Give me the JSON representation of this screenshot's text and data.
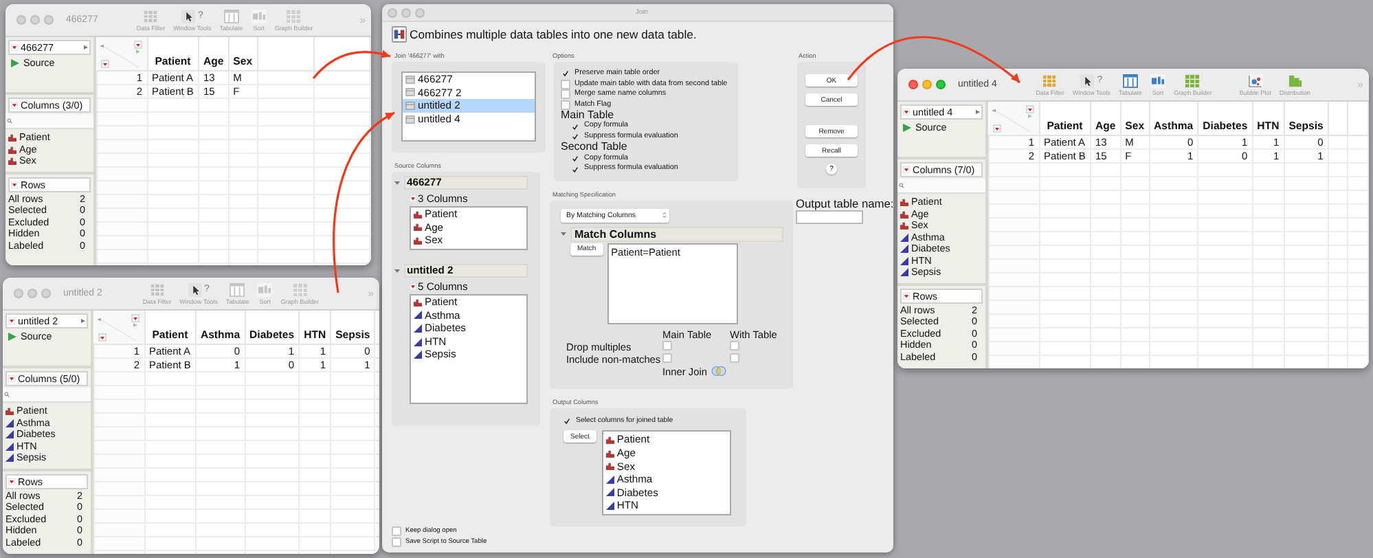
{
  "windows": [
    {
      "title": "466277",
      "active": false,
      "toolbar": [
        {
          "kind": "data-filter",
          "label": "Data Filter"
        },
        {
          "kind": "window-tools",
          "label": "Window Tools",
          "glyph": "?"
        },
        {
          "kind": "tabulate",
          "label": "Tabulate"
        },
        {
          "kind": "sort",
          "label": "Sort"
        },
        {
          "kind": "graph-builder",
          "label": "Graph Builder"
        }
      ],
      "overflow": "»",
      "table_name": "466277",
      "source": "Source",
      "columns_header": "Columns (3/0)",
      "columns": [
        {
          "name": "Patient",
          "kind": "nominal"
        },
        {
          "name": "Age",
          "kind": "nominal"
        },
        {
          "name": "Sex",
          "kind": "nominal"
        }
      ],
      "rows_header": "Rows",
      "row_stats": [
        {
          "label": "All rows",
          "value": "2"
        },
        {
          "label": "Selected",
          "value": "0"
        },
        {
          "label": "Excluded",
          "value": "0"
        },
        {
          "label": "Hidden",
          "value": "0"
        },
        {
          "label": "Labeled",
          "value": "0"
        }
      ],
      "grid_columns": [
        {
          "name": "Patient",
          "kind": "nominal"
        },
        {
          "name": "Age",
          "kind": "nominal"
        },
        {
          "name": "Sex",
          "kind": "nominal"
        }
      ],
      "data_rows": [
        {
          "number": "1",
          "cells": [
            "Patient A",
            "13",
            "M"
          ]
        },
        {
          "number": "2",
          "cells": [
            "Patient B",
            "15",
            "F"
          ]
        }
      ]
    },
    {
      "title": "untitled 2",
      "active": false,
      "toolbar": [
        {
          "kind": "data-filter",
          "label": "Data Filter"
        },
        {
          "kind": "window-tools",
          "label": "Window Tools",
          "glyph": "?"
        },
        {
          "kind": "tabulate",
          "label": "Tabulate"
        },
        {
          "kind": "sort",
          "label": "Sort"
        },
        {
          "kind": "graph-builder",
          "label": "Graph Builder"
        }
      ],
      "overflow": "»",
      "table_name": "untitled 2",
      "source": "Source",
      "columns_header": "Columns (5/0)",
      "columns": [
        {
          "name": "Patient",
          "kind": "nominal"
        },
        {
          "name": "Asthma",
          "kind": "continuous"
        },
        {
          "name": "Diabetes",
          "kind": "continuous"
        },
        {
          "name": "HTN",
          "kind": "continuous"
        },
        {
          "name": "Sepsis",
          "kind": "continuous"
        }
      ],
      "rows_header": "Rows",
      "row_stats": [
        {
          "label": "All rows",
          "value": "2"
        },
        {
          "label": "Selected",
          "value": "0"
        },
        {
          "label": "Excluded",
          "value": "0"
        },
        {
          "label": "Hidden",
          "value": "0"
        },
        {
          "label": "Labeled",
          "value": "0"
        }
      ],
      "grid_columns": [
        {
          "name": "Patient",
          "kind": "nominal"
        },
        {
          "name": "Asthma",
          "kind": "continuous"
        },
        {
          "name": "Diabetes",
          "kind": "continuous"
        },
        {
          "name": "HTN",
          "kind": "continuous"
        },
        {
          "name": "Sepsis",
          "kind": "continuous"
        }
      ],
      "data_rows": [
        {
          "number": "1",
          "cells": [
            "Patient A",
            "0",
            "1",
            "1",
            "0"
          ]
        },
        {
          "number": "2",
          "cells": [
            "Patient B",
            "1",
            "0",
            "1",
            "1"
          ]
        }
      ]
    },
    {
      "title": "untitled 4",
      "active": true,
      "toolbar": [
        {
          "kind": "data-filter",
          "label": "Data Filter"
        },
        {
          "kind": "window-tools",
          "label": "Window Tools",
          "glyph": "?"
        },
        {
          "kind": "tabulate",
          "label": "Tabulate"
        },
        {
          "kind": "sort",
          "label": "Sort"
        },
        {
          "kind": "graph-builder",
          "label": "Graph Builder"
        },
        {
          "kind": "bubble-plot",
          "label": "Bubble Plot"
        },
        {
          "kind": "distribution",
          "label": "Distribution"
        }
      ],
      "overflow": "»",
      "table_name": "untitled 4",
      "source": "Source",
      "columns_header": "Columns (7/0)",
      "columns": [
        {
          "name": "Patient",
          "kind": "nominal"
        },
        {
          "name": "Age",
          "kind": "nominal"
        },
        {
          "name": "Sex",
          "kind": "nominal"
        },
        {
          "name": "Asthma",
          "kind": "continuous"
        },
        {
          "name": "Diabetes",
          "kind": "continuous"
        },
        {
          "name": "HTN",
          "kind": "continuous"
        },
        {
          "name": "Sepsis",
          "kind": "continuous"
        }
      ],
      "rows_header": "Rows",
      "row_stats": [
        {
          "label": "All rows",
          "value": "2"
        },
        {
          "label": "Selected",
          "value": "0"
        },
        {
          "label": "Excluded",
          "value": "0"
        },
        {
          "label": "Hidden",
          "value": "0"
        },
        {
          "label": "Labeled",
          "value": "0"
        }
      ],
      "grid_columns": [
        {
          "name": "Patient",
          "kind": "nominal"
        },
        {
          "name": "Age",
          "kind": "nominal"
        },
        {
          "name": "Sex",
          "kind": "nominal"
        },
        {
          "name": "Asthma",
          "kind": "continuous"
        },
        {
          "name": "Diabetes",
          "kind": "continuous"
        },
        {
          "name": "HTN",
          "kind": "continuous"
        },
        {
          "name": "Sepsis",
          "kind": "continuous"
        }
      ],
      "data_rows": [
        {
          "number": "1",
          "cells": [
            "Patient A",
            "13",
            "M",
            "0",
            "1",
            "1",
            "0"
          ]
        },
        {
          "number": "2",
          "cells": [
            "Patient B",
            "15",
            "F",
            "1",
            "0",
            "1",
            "1"
          ]
        }
      ]
    }
  ],
  "join_dialog": {
    "title": "Join",
    "description": "Combines multiple data tables into one new data table.",
    "join_with": {
      "label": "Join '466277' with",
      "tables": [
        {
          "name": "466277",
          "selected": false
        },
        {
          "name": "466277 2",
          "selected": false
        },
        {
          "name": "untitled 2",
          "selected": true
        },
        {
          "name": "untitled 4",
          "selected": false
        }
      ]
    },
    "source_columns": {
      "label": "Source Columns",
      "tables": [
        {
          "name": "466277",
          "count": "3 Columns",
          "columns": [
            {
              "name": "Patient",
              "kind": "nominal"
            },
            {
              "name": "Age",
              "kind": "nominal"
            },
            {
              "name": "Sex",
              "kind": "nominal"
            }
          ]
        },
        {
          "name": "untitled 2",
          "count": "5 Columns",
          "columns": [
            {
              "name": "Patient",
              "kind": "nominal"
            },
            {
              "name": "Asthma",
              "kind": "continuous"
            },
            {
              "name": "Diabetes",
              "kind": "continuous"
            },
            {
              "name": "HTN",
              "kind": "continuous"
            },
            {
              "name": "Sepsis",
              "kind": "continuous"
            }
          ]
        }
      ]
    },
    "options": {
      "label": "Options",
      "items": [
        {
          "kind": "checkbox",
          "label": "Preserve main table order",
          "checked": true
        },
        {
          "kind": "checkbox",
          "label": "Update main table with data from second table",
          "checked": false
        },
        {
          "kind": "checkbox",
          "label": "Merge same name columns",
          "checked": false
        },
        {
          "kind": "checkbox",
          "label": "Match Flag",
          "checked": false
        },
        {
          "kind": "group",
          "label": "Main Table",
          "children": [
            {
              "label": "Copy formula",
              "checked": true
            },
            {
              "label": "Suppress formula evaluation",
              "checked": true
            }
          ]
        },
        {
          "kind": "group",
          "label": "Second Table",
          "children": [
            {
              "label": "Copy formula",
              "checked": true
            },
            {
              "label": "Suppress formula evaluation",
              "checked": true
            }
          ]
        }
      ]
    },
    "matching": {
      "label": "Matching Specification",
      "method": "By Matching Columns",
      "section": "Match Columns",
      "match_button": "Match",
      "pairs": [
        "Patient=Patient"
      ],
      "main_header": "Main Table",
      "with_header": "With Table",
      "settings": [
        {
          "label": "Drop multiples",
          "main": false,
          "with": false
        },
        {
          "label": "Include non-matches",
          "main": false,
          "with": false
        }
      ],
      "join_type": "Inner Join"
    },
    "output_columns": {
      "label": "Output Columns",
      "select_checkbox": {
        "label": "Select columns for joined table",
        "checked": true
      },
      "select_button": "Select",
      "columns": [
        {
          "name": "Patient",
          "kind": "nominal"
        },
        {
          "name": "Age",
          "kind": "nominal"
        },
        {
          "name": "Sex",
          "kind": "nominal"
        },
        {
          "name": "Asthma",
          "kind": "continuous"
        },
        {
          "name": "Diabetes",
          "kind": "continuous"
        },
        {
          "name": "HTN",
          "kind": "continuous"
        }
      ]
    },
    "action": {
      "label": "Action",
      "buttons": [
        {
          "label": "OK",
          "kind": "push"
        },
        {
          "label": "Cancel",
          "kind": "push"
        },
        {
          "label": "Remove",
          "kind": "push"
        },
        {
          "label": "Recall",
          "kind": "push"
        },
        {
          "label": "?",
          "kind": "help"
        }
      ]
    },
    "output_name": {
      "label": "Output table name:"
    },
    "footer": [
      {
        "label": "Keep dialog open",
        "checked": false
      },
      {
        "label": "Save Script to Source Table",
        "checked": false
      }
    ]
  }
}
